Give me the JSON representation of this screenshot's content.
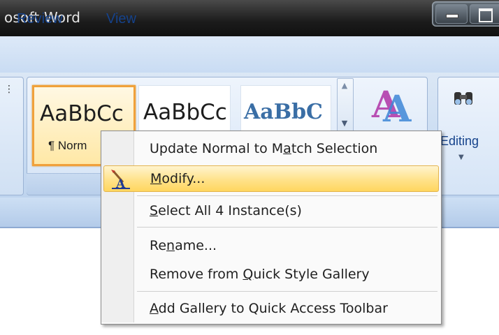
{
  "window": {
    "title": "osoft Word"
  },
  "tabs": [
    "Review",
    "View"
  ],
  "styles_gallery": [
    {
      "sample": "AaBbCc",
      "caption": "¶ Norm",
      "selected": true
    },
    {
      "sample": "AaBbCc",
      "caption": ""
    },
    {
      "sample": "AaBbC",
      "caption": ""
    }
  ],
  "editing": {
    "label": "Editing"
  },
  "context_menu": {
    "items": [
      {
        "pre": "Update Normal to M",
        "key": "a",
        "post": "tch Selection"
      },
      {
        "pre": "",
        "key": "M",
        "post": "odify...",
        "highlighted": true
      },
      {
        "pre": "",
        "key": "S",
        "post": "elect All 4 Instance(s)"
      },
      {
        "pre": "Re",
        "key": "n",
        "post": "ame..."
      },
      {
        "pre": "Remove from ",
        "key": "Q",
        "post": "uick Style Gallery"
      },
      {
        "pre": "",
        "key": "A",
        "post": "dd Gallery to Quick Access Toolbar"
      }
    ]
  },
  "colors": {
    "tab_text": "#15428b",
    "highlight": "#ffe28a",
    "selected_style_border": "#f0a13b"
  }
}
